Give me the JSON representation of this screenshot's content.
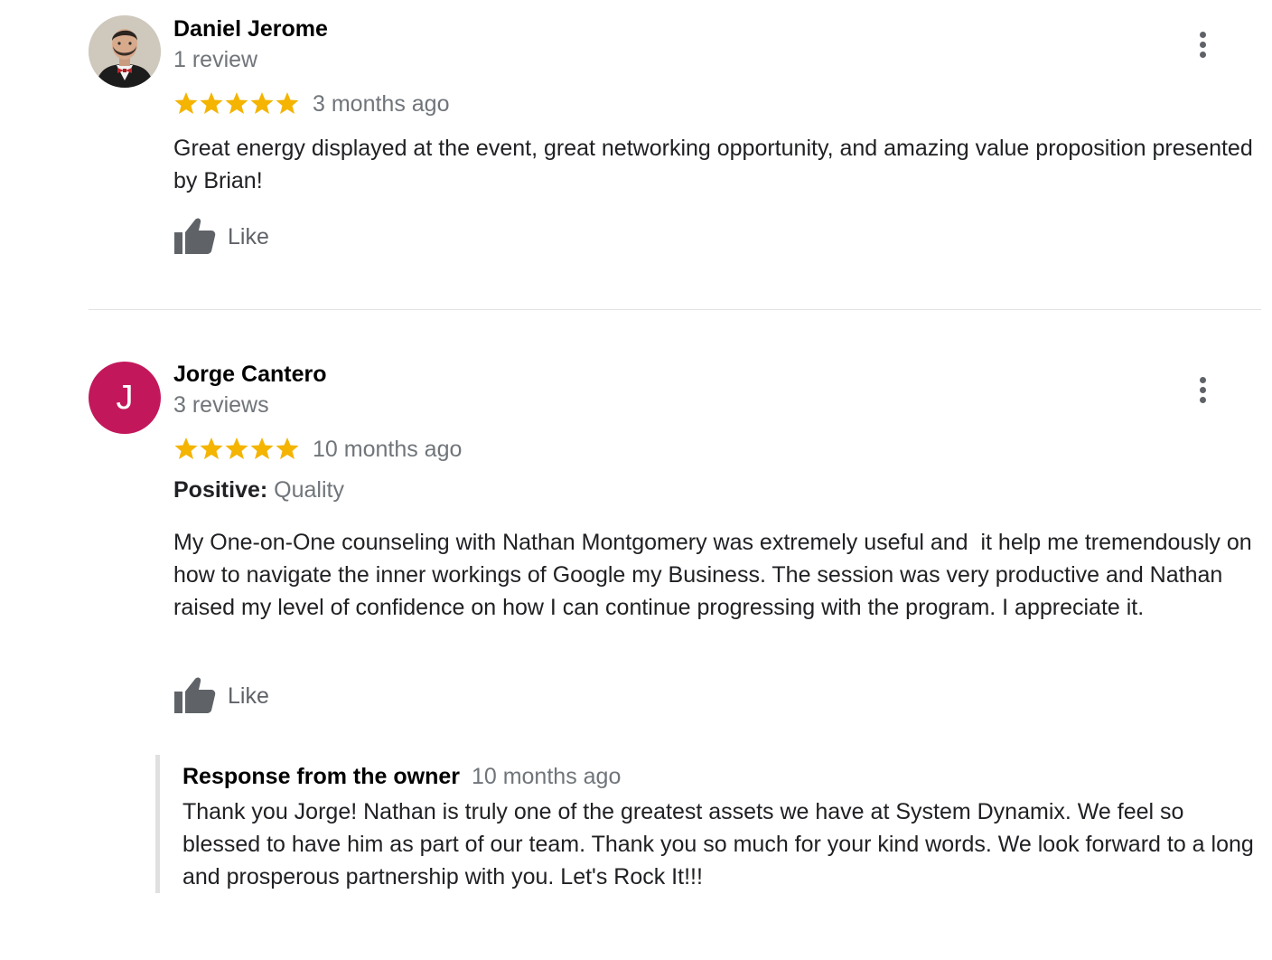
{
  "colors": {
    "star": "#f4b400",
    "secondary_text": "#70757a",
    "avatar_j": "#c2185b",
    "icon": "#5f6368"
  },
  "reviews": [
    {
      "reviewer": "Daniel Jerome",
      "review_count": "1 review",
      "rating": 5,
      "time": "3 months ago",
      "text": "Great energy displayed at the event, great networking opportunity, and amazing value proposition presented by Brian!",
      "like_label": "Like",
      "avatar": "photo"
    },
    {
      "reviewer": "Jorge Cantero",
      "review_count": "3 reviews",
      "rating": 5,
      "time": "10 months ago",
      "avatar_letter": "J",
      "highlights_label": "Positive:",
      "highlights_value": "Quality",
      "text": "My One-on-One counseling with Nathan Montgomery was extremely useful and  it help me tremendously on how to navigate the inner workings of Google my Business. The session was very productive and Nathan raised my level of confidence on how I can continue progressing with the program. I appreciate it.",
      "like_label": "Like",
      "owner_response": {
        "title": "Response from the owner",
        "time": "10 months ago",
        "text": "Thank you Jorge! Nathan is truly one of the greatest assets we have at System Dynamix. We feel so blessed to have him as part of our team. Thank you so much for your kind words. We look forward to a long and prosperous partnership with you. Let's Rock It!!!"
      }
    }
  ]
}
